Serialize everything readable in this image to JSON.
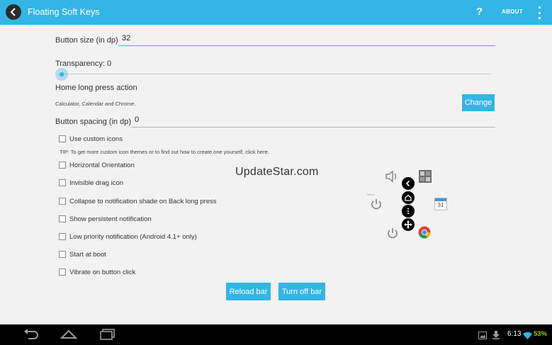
{
  "actionbar": {
    "title": "Floating Soft Keys",
    "help": "?",
    "about": "ABOUT",
    "icons": [
      "back-arrow-icon",
      "overflow-menu-icon"
    ]
  },
  "settings": {
    "button_size_label": "Button size (in dp)",
    "button_size_value": "32",
    "transparency_label": "Transparency: 0",
    "transparency_value": 0,
    "home_long_press_label": "Home long press action",
    "home_long_press_summary": "Calculator, Calendar and Chrome.",
    "change_button": "Change",
    "button_spacing_label": "Button spacing (in dp)",
    "button_spacing_value": "0",
    "use_custom_icons": "Use custom icons",
    "tip": "TIP: To get more custom icon themes or to find out how to create one yourself, click here.",
    "checkboxes": [
      {
        "label": "Horizontal Orientation",
        "checked": false
      },
      {
        "label": "Invisible drag icon",
        "checked": false
      },
      {
        "label": "Collapse to notification shade on Back long press",
        "checked": false
      },
      {
        "label": "Show persistent notification",
        "checked": false
      },
      {
        "label": "Low priority notification (Android 4.1+ only)",
        "checked": false
      },
      {
        "label": "Start at boot",
        "checked": false
      },
      {
        "label": "Vibrate on button click",
        "checked": false
      }
    ],
    "use_custom_icons_checked": false,
    "reload_button": "Reload bar",
    "turn_off_button": "Turn off bar"
  },
  "watermark": "UpdateStar.com",
  "floating_preview": {
    "icons": [
      "volume-icon",
      "calculator-icon",
      "power-icon",
      "back-icon",
      "home-icon",
      "menu-icon",
      "move-icon",
      "calendar-icon",
      "power-icon",
      "chrome-icon"
    ],
    "calendar_day": "31",
    "power_caption": "WWO"
  },
  "status_bar": {
    "time": "6:13",
    "battery": "53%",
    "accent": "#99cc00"
  },
  "colors": {
    "accent": "#33b5e5",
    "background": "#f2f2f2",
    "navbar": "#000000"
  }
}
